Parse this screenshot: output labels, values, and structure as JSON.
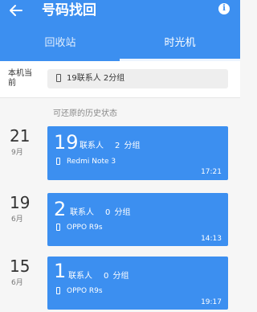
{
  "appbar": {
    "title": "号码找回",
    "back_icon": "arrow-left-icon",
    "info_icon": "info-icon",
    "info_glyph": "i",
    "tabs": [
      {
        "label": "回收站",
        "selected": false
      },
      {
        "label": "时光机",
        "selected": true
      }
    ]
  },
  "current_device": {
    "label": "本机当前",
    "icon": "phone-icon",
    "summary": "19联系人  2分组"
  },
  "history": {
    "header": "可还原的历史状态",
    "entries": [
      {
        "day": "21",
        "month": "9月",
        "contacts": "19",
        "contacts_unit": "联系人",
        "groups": "2 分组",
        "device": "Redmi Note 3",
        "time": "17:21"
      },
      {
        "day": "19",
        "month": "6月",
        "contacts": "2",
        "contacts_unit": "联系人",
        "groups": "0 分组",
        "device": "OPPO R9s",
        "time": "14:13"
      },
      {
        "day": "15",
        "month": "6月",
        "contacts": "1",
        "contacts_unit": "联系人",
        "groups": "0 分组",
        "device": "OPPO R9s",
        "time": "19:17"
      }
    ]
  },
  "colors": {
    "primary": "#3c8ff0",
    "background": "#f6f6f6"
  }
}
